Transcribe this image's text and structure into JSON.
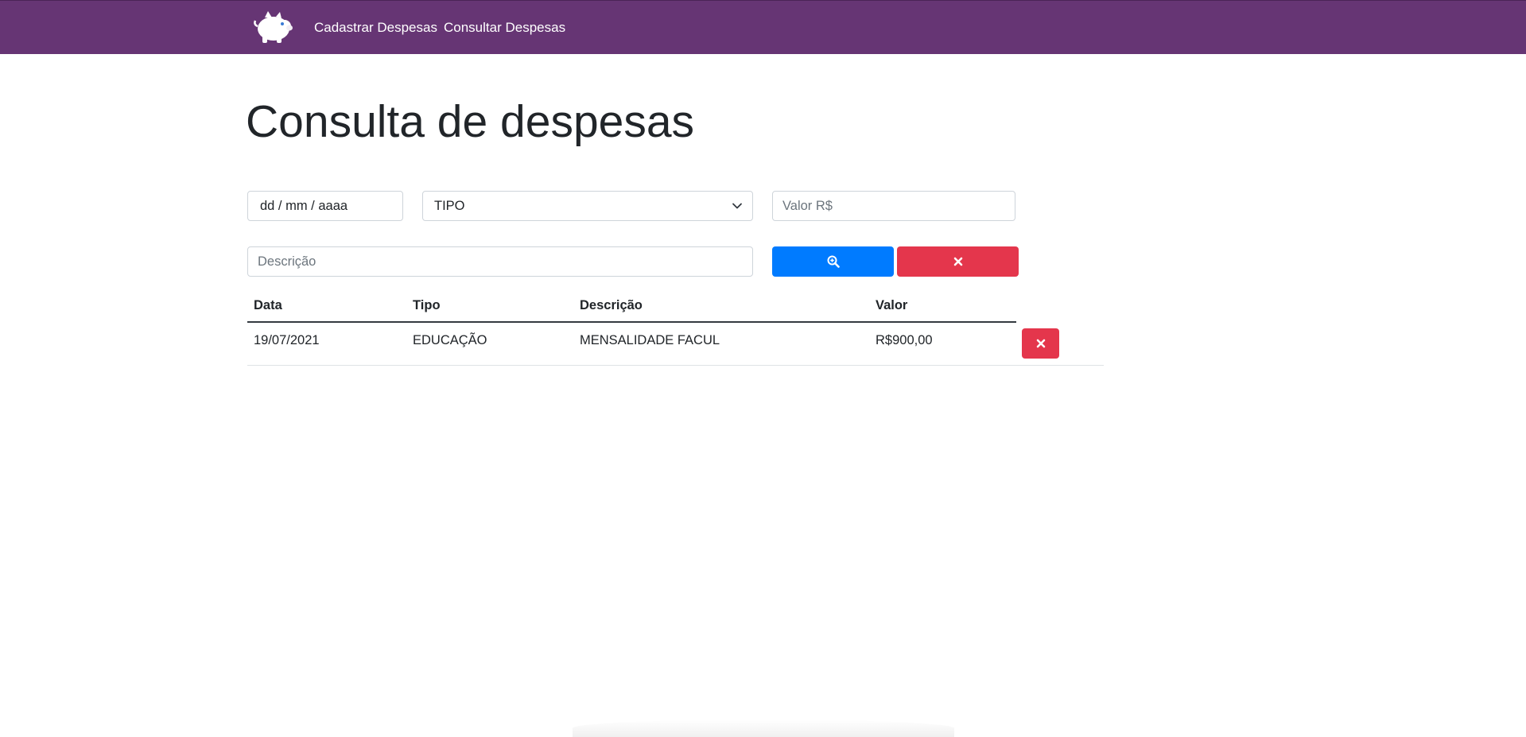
{
  "navbar": {
    "logo_icon": "piggy-bank-icon",
    "links": [
      {
        "label": "Cadastrar Despesas"
      },
      {
        "label": "Consultar Despesas"
      }
    ],
    "background": "#663574"
  },
  "page": {
    "title": "Consulta de despesas"
  },
  "filters": {
    "date_placeholder": "dd / mm / aaaa",
    "tipo_selected": "TIPO",
    "valor_placeholder": "Valor R$",
    "descricao_placeholder": "Descrição",
    "search_icon": "zoom-in-icon",
    "clear_icon": "close-icon"
  },
  "table": {
    "headers": {
      "data": "Data",
      "tipo": "Tipo",
      "descricao": "Descrição",
      "valor": "Valor"
    },
    "rows": [
      {
        "data": "19/07/2021",
        "tipo": "EDUCAÇÃO",
        "descricao": "MENSALIDADE FACUL",
        "valor": "R$900,00",
        "delete_icon": "close-icon"
      }
    ]
  },
  "colors": {
    "primary": "#007bff",
    "danger": "#e4364c"
  }
}
